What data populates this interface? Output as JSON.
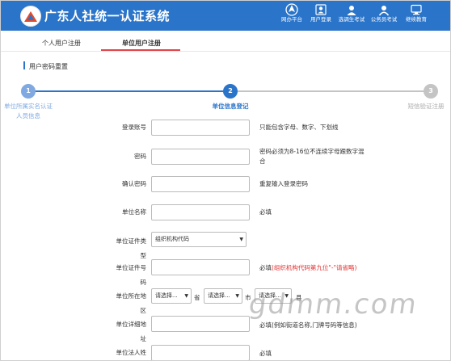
{
  "site": {
    "title": "广东人社统一认证系统"
  },
  "nav": [
    {
      "label": "网办平台",
      "icon": "globe-icon"
    },
    {
      "label": "用户登录",
      "icon": "user-login-icon"
    },
    {
      "label": "选调生考试",
      "icon": "exam-icon"
    },
    {
      "label": "公务员考试",
      "icon": "civil-exam-icon"
    },
    {
      "label": "继续教育",
      "icon": "education-icon"
    }
  ],
  "tabs": [
    {
      "label": "个人用户注册",
      "active": false
    },
    {
      "label": "单位用户注册",
      "active": true
    }
  ],
  "section": {
    "title": "用户密码重置"
  },
  "steps": [
    {
      "num": "1",
      "label": "单位所属实名认证人员信息",
      "state": "done"
    },
    {
      "num": "2",
      "label": "单位信息登记",
      "state": "active"
    },
    {
      "num": "3",
      "label": "短信验证注册",
      "state": "pending"
    }
  ],
  "form": {
    "account": {
      "label": "登录账号",
      "value": "",
      "hint": "只能包含字母、数字、下划线"
    },
    "password": {
      "label": "密码",
      "value": "",
      "hint": "密码必须为8-16位不连续字母跟数字混合"
    },
    "confirm": {
      "label": "确认密码",
      "value": "",
      "hint": "重复输入登录密码"
    },
    "org_name": {
      "label": "单位名称",
      "value": "",
      "hint": "必填"
    },
    "cert_type": {
      "label": "单位证件类型",
      "value": "组织机构代码"
    },
    "cert_no": {
      "label": "单位证件号码",
      "value": "",
      "hint": "必填",
      "hint_red": "(组织机构代码第九位\"-\"请省略)"
    },
    "region": {
      "label": "单位所在地区",
      "province": "请选择...",
      "city": "请选择...",
      "county": "请选择...",
      "province_unit": "省",
      "city_unit": "市",
      "county_unit": "县"
    },
    "address": {
      "label": "单位详细地址",
      "value": "",
      "hint": "必填(例如街道名称,门牌号码等信息)"
    },
    "legal": {
      "label": "单位法人姓",
      "value": "",
      "hint": "必填"
    }
  },
  "watermark": "gdmm.com",
  "colors": {
    "header": "#2a74c9",
    "step_active": "#2a74c9",
    "step_pending": "#c4c4c4",
    "accent_red": "#e0464b"
  }
}
